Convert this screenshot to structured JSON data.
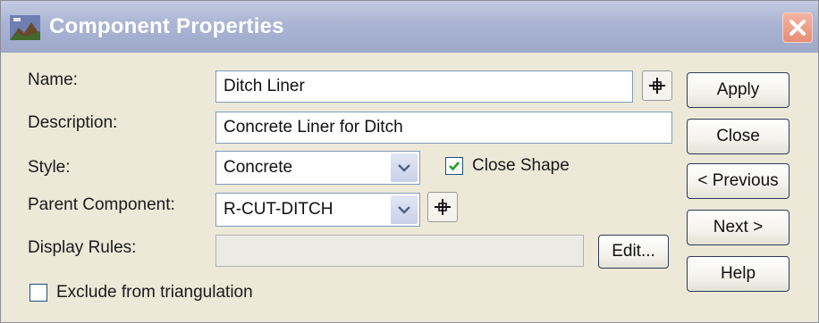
{
  "window": {
    "title": "Component Properties"
  },
  "form": {
    "name_label": "Name:",
    "name_value": "Ditch Liner",
    "description_label": "Description:",
    "description_value": "Concrete Liner for Ditch",
    "style_label": "Style:",
    "style_value": "Concrete",
    "close_shape_label": "Close Shape",
    "close_shape_checked": true,
    "parent_label": "Parent Component:",
    "parent_value": "R-CUT-DITCH",
    "display_rules_label": "Display Rules:",
    "display_rules_value": "",
    "edit_label": "Edit...",
    "exclude_label": "Exclude from triangulation",
    "exclude_checked": false
  },
  "buttons": {
    "apply": "Apply",
    "close": "Close",
    "previous": "< Previous",
    "next": "Next >",
    "help": "Help"
  },
  "colors": {
    "titlebar": "#aab4d3",
    "dialog_bg": "#ece9d8",
    "close_button": "#e88d76",
    "check_mark": "#21a121"
  },
  "icons": {
    "app": "app-icon",
    "close": "close-icon",
    "pick": "crosshair-icon",
    "dropdown": "chevron-down-icon",
    "check": "checkmark-icon"
  }
}
